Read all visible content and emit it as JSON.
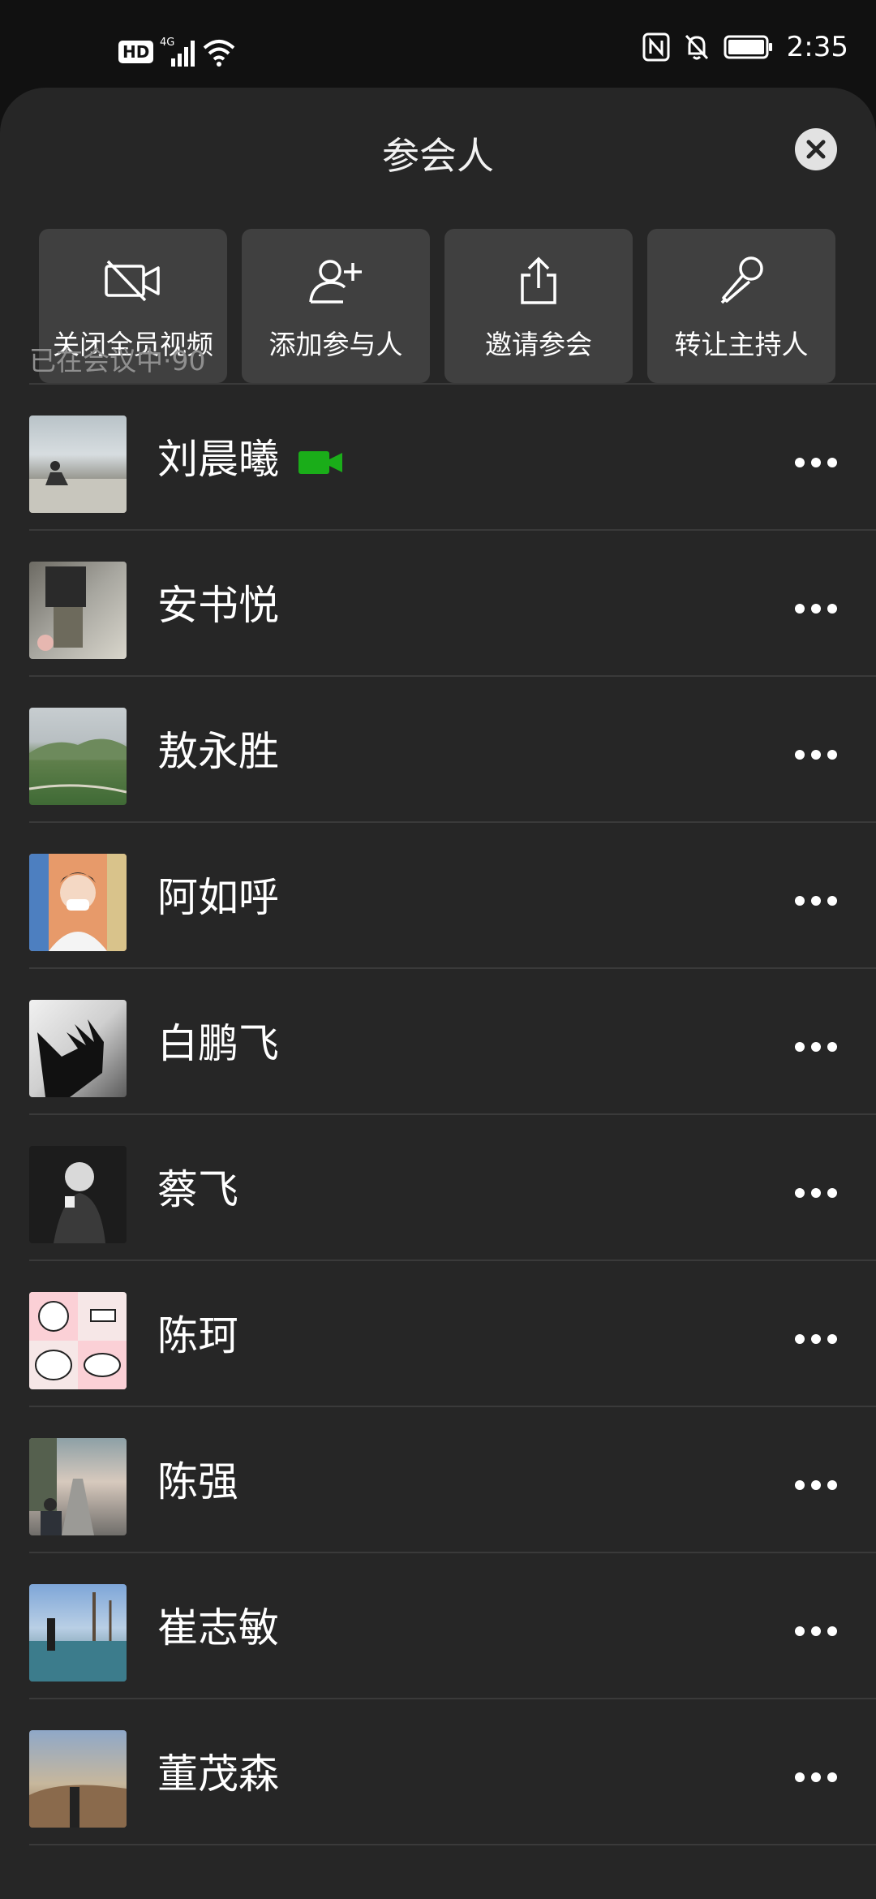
{
  "status_bar": {
    "hd": "HD",
    "network": "4G",
    "time": "2:35",
    "icons": [
      "signal-icon",
      "wifi-icon",
      "nfc-icon",
      "bell-off-icon",
      "battery-icon"
    ]
  },
  "header": {
    "title": "参会人",
    "close_icon": "close-icon"
  },
  "actions": [
    {
      "label": "关闭全员视频",
      "icon": "video-off-icon"
    },
    {
      "label": "添加参与人",
      "icon": "add-person-icon"
    },
    {
      "label": "邀请参会",
      "icon": "share-icon"
    },
    {
      "label": "转让主持人",
      "icon": "microphone-icon"
    }
  ],
  "section": {
    "label": "已在会议中·90"
  },
  "participants": [
    {
      "name": "刘晨曦",
      "video_on": true
    },
    {
      "name": "安书悦"
    },
    {
      "name": "敖永胜"
    },
    {
      "name": "阿如呼"
    },
    {
      "name": "白鹏飞"
    },
    {
      "name": "蔡飞"
    },
    {
      "name": "陈珂"
    },
    {
      "name": "陈强"
    },
    {
      "name": "崔志敏"
    },
    {
      "name": "董茂森"
    }
  ],
  "colors": {
    "sheet_bg": "#262626",
    "tile_bg": "#404040",
    "video_on": "#1aad19"
  }
}
